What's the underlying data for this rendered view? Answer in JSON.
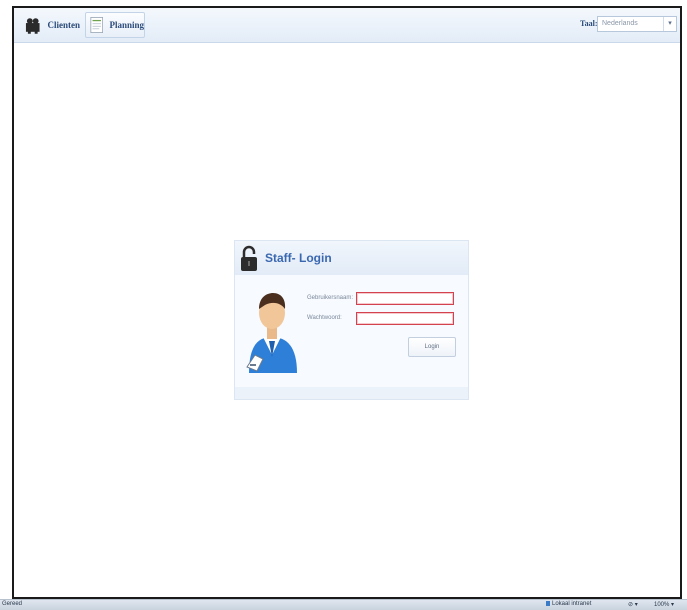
{
  "toolbar": {
    "clienten_label": "Clienten",
    "planning_label": "Planning",
    "taal_label": "Taal:",
    "taal_value": "Nederlands",
    "taal_arrow": "▾"
  },
  "login": {
    "title": "Staff- Login",
    "username_label": "Gebruikersnaam:",
    "username_value": "",
    "password_label": "Wachtwoord:",
    "password_value": "",
    "button_label": "Login"
  },
  "statusbar": {
    "left_text": "Gereed",
    "zone_text": "Lokaal intranet",
    "zoom_controls": "⊘ ▾",
    "zoom": "100% ▾"
  },
  "colors": {
    "accent": "#3a68b0",
    "error_border": "#d2424f",
    "panel_bg": "#ecf2fa"
  },
  "icons": {
    "clienten": "people-icon",
    "planning": "document-icon",
    "lock": "padlock-icon",
    "user": "user-avatar-icon"
  }
}
